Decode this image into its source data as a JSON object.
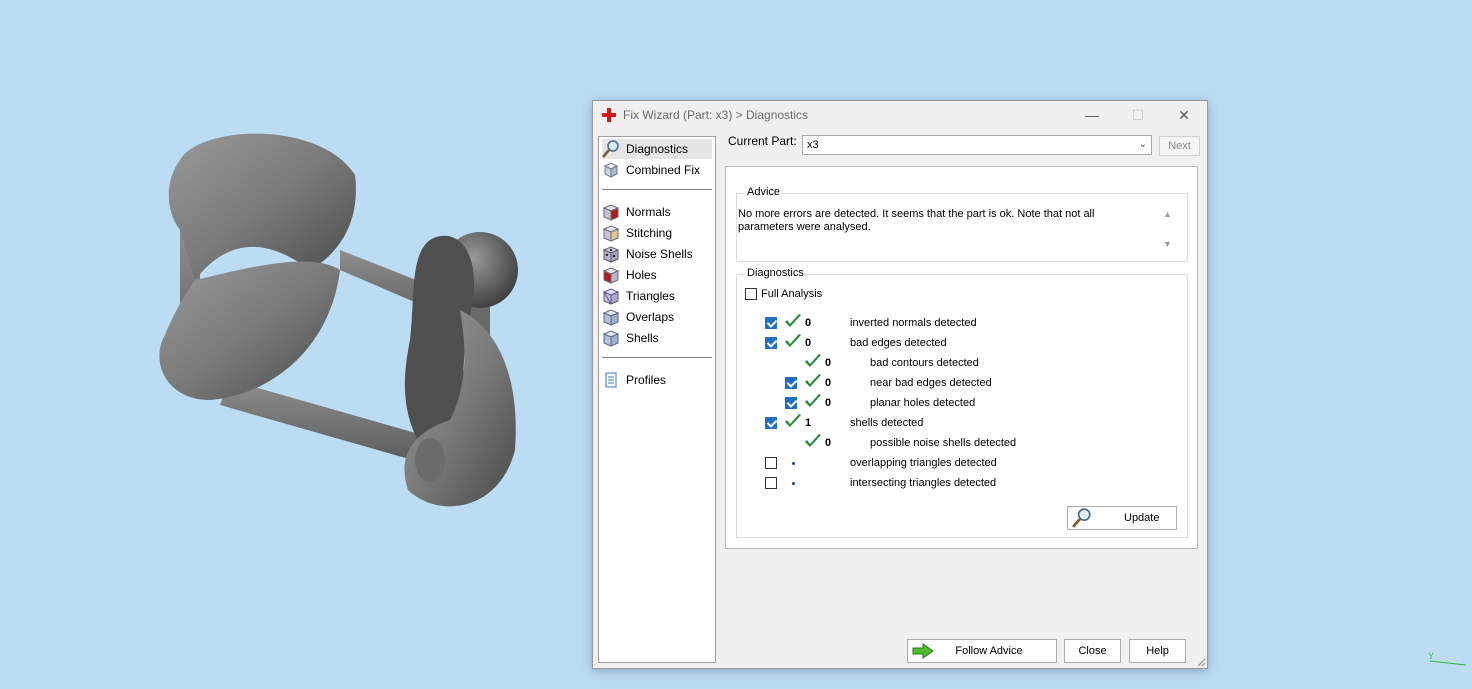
{
  "window": {
    "title": "Fix Wizard (Part: x3) > Diagnostics"
  },
  "nav": {
    "items": [
      {
        "label": "Diagnostics",
        "icon": "magnifier-icon"
      },
      {
        "label": "Combined Fix",
        "icon": "cube-icon"
      },
      {
        "label": "Normals",
        "icon": "normals-cube-icon"
      },
      {
        "label": "Stitching",
        "icon": "stitching-cube-icon"
      },
      {
        "label": "Noise Shells",
        "icon": "noise-shells-icon"
      },
      {
        "label": "Holes",
        "icon": "holes-cube-icon"
      },
      {
        "label": "Triangles",
        "icon": "triangles-cube-icon"
      },
      {
        "label": "Overlaps",
        "icon": "overlaps-cube-icon"
      },
      {
        "label": "Shells",
        "icon": "shells-cube-icon"
      },
      {
        "label": "Profiles",
        "icon": "document-icon"
      }
    ],
    "selected": "Diagnostics"
  },
  "current_part": {
    "label": "Current Part:",
    "value": "x3"
  },
  "next_label": "Next",
  "advice": {
    "title": "Advice",
    "text": "No more errors are detected. It seems that the part is ok. Note that not all parameters were analysed."
  },
  "diagnostics": {
    "title": "Diagnostics",
    "full_analysis_label": "Full Analysis",
    "full_analysis_checked": false,
    "rows": [
      {
        "checkbox": true,
        "checked": true,
        "status": "check",
        "count": "0",
        "label": "inverted normals detected",
        "indent": 0
      },
      {
        "checkbox": true,
        "checked": true,
        "status": "check",
        "count": "0",
        "label": "bad edges detected",
        "indent": 0
      },
      {
        "checkbox": false,
        "checked": false,
        "status": "check",
        "count": "0",
        "label": "bad contours detected",
        "indent": 1
      },
      {
        "checkbox": true,
        "checked": true,
        "status": "check",
        "count": "0",
        "label": "near bad edges detected",
        "indent": 1
      },
      {
        "checkbox": true,
        "checked": true,
        "status": "check",
        "count": "0",
        "label": "planar holes detected",
        "indent": 1
      },
      {
        "checkbox": true,
        "checked": true,
        "status": "check",
        "count": "1",
        "label": "shells detected",
        "indent": 0
      },
      {
        "checkbox": false,
        "checked": false,
        "status": "check",
        "count": "0",
        "label": "possible noise shells detected",
        "indent": 1
      },
      {
        "checkbox": true,
        "checked": false,
        "status": "dot",
        "count": "",
        "label": "overlapping triangles detected",
        "indent": 0
      },
      {
        "checkbox": true,
        "checked": false,
        "status": "dot",
        "count": "",
        "label": "intersecting triangles detected",
        "indent": 0
      }
    ],
    "update_label": "Update"
  },
  "footer": {
    "follow_advice": "Follow Advice",
    "close": "Close",
    "help": "Help"
  },
  "colors": {
    "background": "#bcdcf4",
    "check_green": "#2a8a3a",
    "checkbox_blue": "#1f6fc4"
  }
}
